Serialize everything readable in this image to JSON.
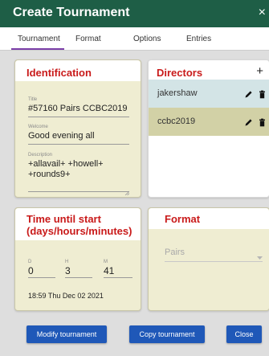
{
  "dialog": {
    "title": "Create Tournament",
    "close_symbol": "×"
  },
  "tabs": [
    {
      "label": "Tournament"
    },
    {
      "label": "Format"
    },
    {
      "label": "Options"
    },
    {
      "label": "Entries"
    }
  ],
  "identification": {
    "title": "Identification",
    "fields": {
      "title_label": "Title",
      "title_value": "#57160 Pairs CCBC2019",
      "welcome_label": "Welcome",
      "welcome_value": "Good evening all",
      "description_label": "Description",
      "description_line1": "+allavail+ +howell+",
      "description_line2": "+rounds9+"
    }
  },
  "directors": {
    "title": "Directors",
    "add_symbol": "+",
    "items": [
      {
        "name": "jakershaw"
      },
      {
        "name": "ccbc2019"
      }
    ]
  },
  "time_until_start": {
    "title_line1": "Time until start",
    "title_line2": "(days/hours/minutes)",
    "days_label": "D",
    "days_value": "0",
    "hours_label": "H",
    "hours_value": "3",
    "minutes_label": "M",
    "minutes_value": "41",
    "start_datetime": "18:59 Thu Dec 02 2021"
  },
  "format": {
    "title": "Format",
    "selected": "Pairs"
  },
  "buttons": {
    "modify": "Modify tournament",
    "copy": "Copy tournament",
    "close": "Close"
  },
  "colors": {
    "titlebar": "#1e5e46",
    "accent_red": "#c91a1a",
    "button_blue": "#1f58b8",
    "director_row_1": "#d3e4e6",
    "director_row_2": "#d2d1a6",
    "tab_underline": "#7b3fa8"
  },
  "icons": {
    "edit": "pencil-icon",
    "delete": "trash-icon",
    "dropdown": "chevron-down-icon"
  }
}
